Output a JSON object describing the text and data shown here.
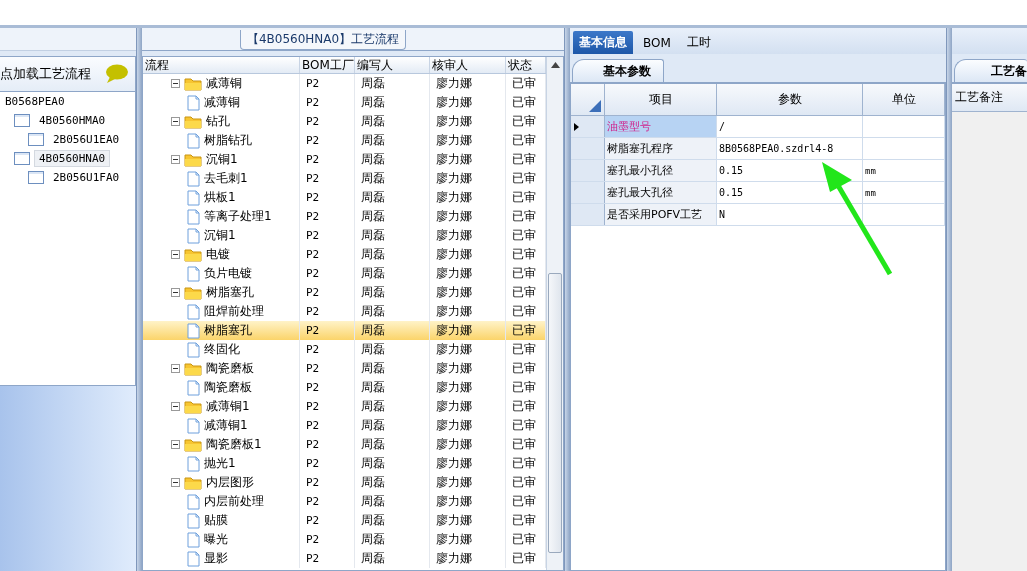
{
  "left_panel": {
    "header": "点加载工艺流程",
    "tree": [
      {
        "label": "B0568PEA0",
        "selected": false,
        "children": [
          {
            "label": "4B0560HMA0",
            "selected": false,
            "children": [
              {
                "label": "2B056U1EA0",
                "selected": false
              }
            ]
          },
          {
            "label": "4B0560HNA0",
            "selected": true,
            "children": [
              {
                "label": "2B056U1FA0",
                "selected": false
              }
            ]
          }
        ]
      }
    ]
  },
  "flow_panel": {
    "title": "【4B0560HNA0】工艺流程",
    "columns": [
      "流程",
      "BOM工厂",
      "编写人",
      "核审人",
      "状态"
    ],
    "rows": [
      {
        "label": "减薄铜",
        "kind": "folder",
        "factory": "P2",
        "author": "周磊",
        "reviewer": "廖力娜",
        "status": "已审",
        "selected": false,
        "children": [
          {
            "label": "减薄铜",
            "kind": "step",
            "factory": "P2",
            "author": "周磊",
            "reviewer": "廖力娜",
            "status": "已审",
            "selected": false
          }
        ]
      },
      {
        "label": "钻孔",
        "kind": "folder",
        "factory": "P2",
        "author": "周磊",
        "reviewer": "廖力娜",
        "status": "已审",
        "selected": false,
        "children": [
          {
            "label": "树脂钻孔",
            "kind": "step",
            "factory": "P2",
            "author": "周磊",
            "reviewer": "廖力娜",
            "status": "已审",
            "selected": false
          }
        ]
      },
      {
        "label": "沉铜1",
        "kind": "folder",
        "factory": "P2",
        "author": "周磊",
        "reviewer": "廖力娜",
        "status": "已审",
        "selected": false,
        "children": [
          {
            "label": "去毛刺1",
            "kind": "step",
            "factory": "P2",
            "author": "周磊",
            "reviewer": "廖力娜",
            "status": "已审",
            "selected": false
          },
          {
            "label": "烘板1",
            "kind": "step",
            "factory": "P2",
            "author": "周磊",
            "reviewer": "廖力娜",
            "status": "已审",
            "selected": false
          },
          {
            "label": "等离子处理1",
            "kind": "step",
            "factory": "P2",
            "author": "周磊",
            "reviewer": "廖力娜",
            "status": "已审",
            "selected": false
          },
          {
            "label": "沉铜1",
            "kind": "step",
            "factory": "P2",
            "author": "周磊",
            "reviewer": "廖力娜",
            "status": "已审",
            "selected": false
          }
        ]
      },
      {
        "label": "电镀",
        "kind": "folder",
        "factory": "P2",
        "author": "周磊",
        "reviewer": "廖力娜",
        "status": "已审",
        "selected": false,
        "children": [
          {
            "label": "负片电镀",
            "kind": "step",
            "factory": "P2",
            "author": "周磊",
            "reviewer": "廖力娜",
            "status": "已审",
            "selected": false
          }
        ]
      },
      {
        "label": "树脂塞孔",
        "kind": "folder",
        "factory": "P2",
        "author": "周磊",
        "reviewer": "廖力娜",
        "status": "已审",
        "selected": false,
        "children": [
          {
            "label": "阻焊前处理",
            "kind": "step",
            "factory": "P2",
            "author": "周磊",
            "reviewer": "廖力娜",
            "status": "已审",
            "selected": false
          },
          {
            "label": "树脂塞孔",
            "kind": "step",
            "factory": "P2",
            "author": "周磊",
            "reviewer": "廖力娜",
            "status": "已审",
            "selected": true
          },
          {
            "label": "终固化",
            "kind": "step",
            "factory": "P2",
            "author": "周磊",
            "reviewer": "廖力娜",
            "status": "已审",
            "selected": false
          }
        ]
      },
      {
        "label": "陶瓷磨板",
        "kind": "folder",
        "factory": "P2",
        "author": "周磊",
        "reviewer": "廖力娜",
        "status": "已审",
        "selected": false,
        "children": [
          {
            "label": "陶瓷磨板",
            "kind": "step",
            "factory": "P2",
            "author": "周磊",
            "reviewer": "廖力娜",
            "status": "已审",
            "selected": false
          }
        ]
      },
      {
        "label": "减薄铜1",
        "kind": "folder",
        "factory": "P2",
        "author": "周磊",
        "reviewer": "廖力娜",
        "status": "已审",
        "selected": false,
        "children": [
          {
            "label": "减薄铜1",
            "kind": "step",
            "factory": "P2",
            "author": "周磊",
            "reviewer": "廖力娜",
            "status": "已审",
            "selected": false
          }
        ]
      },
      {
        "label": "陶瓷磨板1",
        "kind": "folder",
        "factory": "P2",
        "author": "周磊",
        "reviewer": "廖力娜",
        "status": "已审",
        "selected": false,
        "children": [
          {
            "label": "抛光1",
            "kind": "step",
            "factory": "P2",
            "author": "周磊",
            "reviewer": "廖力娜",
            "status": "已审",
            "selected": false
          }
        ]
      },
      {
        "label": "内层图形",
        "kind": "folder",
        "factory": "P2",
        "author": "周磊",
        "reviewer": "廖力娜",
        "status": "已审",
        "selected": false,
        "children": [
          {
            "label": "内层前处理",
            "kind": "step",
            "factory": "P2",
            "author": "周磊",
            "reviewer": "廖力娜",
            "status": "已审",
            "selected": false
          },
          {
            "label": "贴膜",
            "kind": "step",
            "factory": "P2",
            "author": "周磊",
            "reviewer": "廖力娜",
            "status": "已审",
            "selected": false
          },
          {
            "label": "曝光",
            "kind": "step",
            "factory": "P2",
            "author": "周磊",
            "reviewer": "廖力娜",
            "status": "已审",
            "selected": false
          },
          {
            "label": "显影",
            "kind": "step",
            "factory": "P2",
            "author": "周磊",
            "reviewer": "廖力娜",
            "status": "已审",
            "selected": false
          }
        ]
      }
    ]
  },
  "info_panel": {
    "tabs": [
      {
        "label": "基本信息",
        "selected": true
      },
      {
        "label": "BOM",
        "selected": false
      },
      {
        "label": "工时",
        "selected": false
      }
    ],
    "subtab": "基本参数",
    "columns": [
      "项目",
      "参数",
      "单位"
    ],
    "rows": [
      {
        "item": "油墨型号",
        "value": "/",
        "unit": "",
        "selected": true
      },
      {
        "item": "树脂塞孔程序",
        "value": "8B0568PEA0.szdrl4-8",
        "unit": "",
        "selected": false
      },
      {
        "item": "塞孔最小孔径",
        "value": "0.15",
        "unit": "mm",
        "selected": false
      },
      {
        "item": "塞孔最大孔径",
        "value": "0.15",
        "unit": "mm",
        "selected": false
      },
      {
        "item": "是否采用POFV工艺",
        "value": "N",
        "unit": "",
        "selected": false
      }
    ]
  },
  "notes_panel": {
    "tab": "工艺备",
    "header": "工艺备注"
  }
}
